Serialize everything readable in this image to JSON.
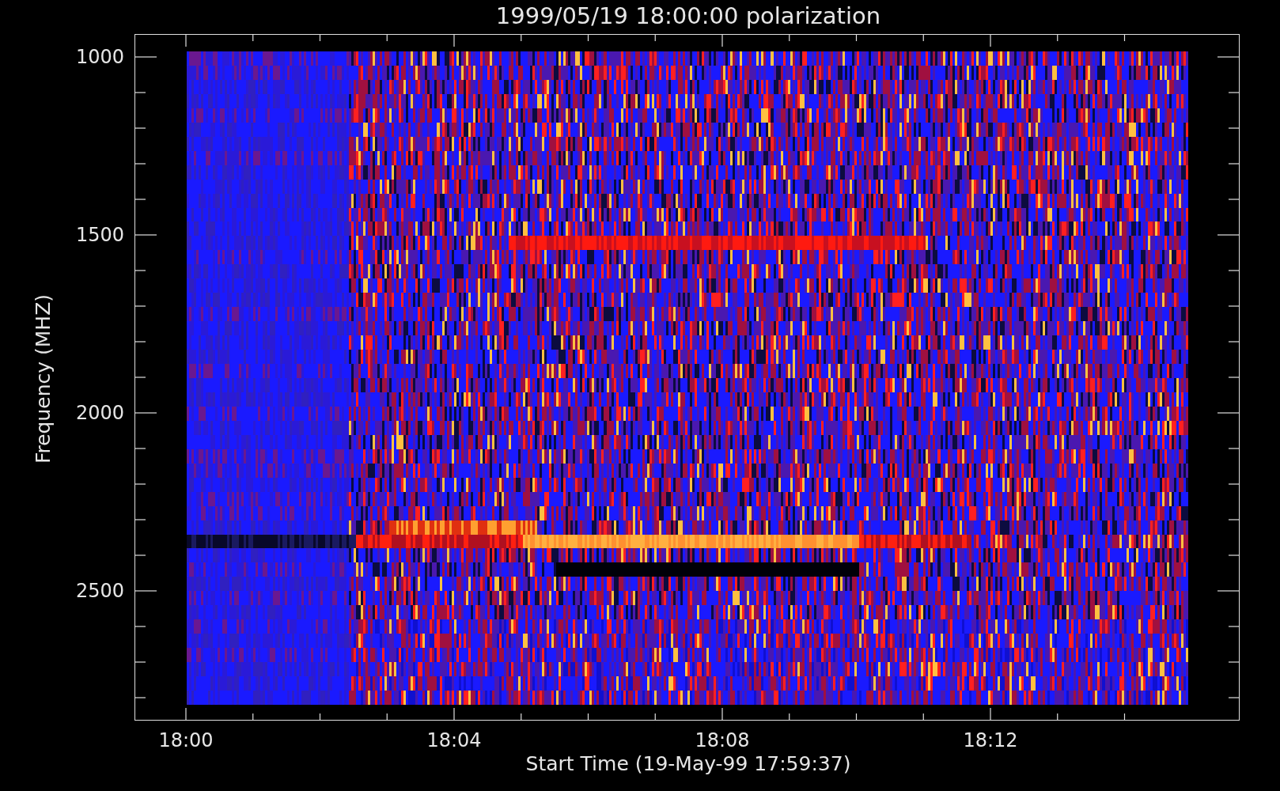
{
  "title": "1999/05/19 18:00:00 polarization",
  "y_axis": {
    "label": "Frequency (MHZ)",
    "ticks": [
      "1000",
      "1500",
      "2000",
      "2500"
    ]
  },
  "x_axis": {
    "label": "Start Time (19-May-99 17:59:37)",
    "ticks": [
      "18:00",
      "18:04",
      "18:08",
      "18:12"
    ]
  }
}
